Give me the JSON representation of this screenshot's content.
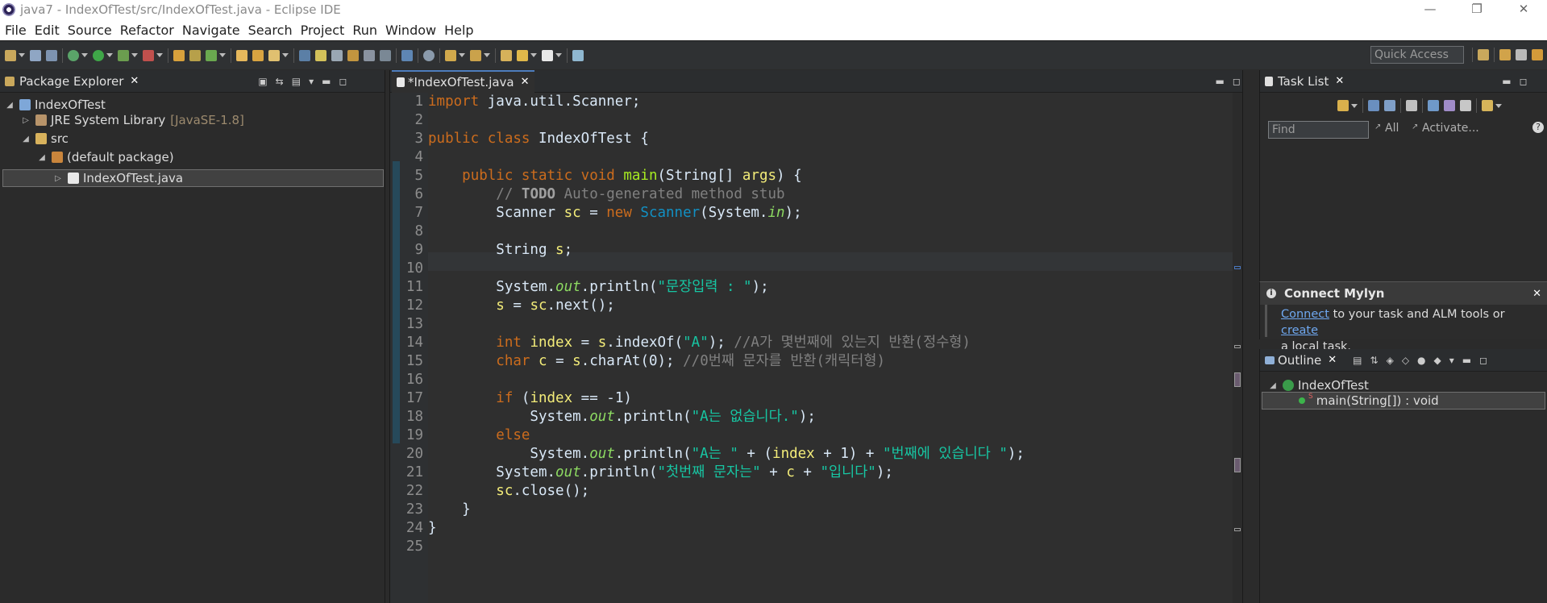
{
  "window": {
    "title": "java7 - IndexOfTest/src/IndexOfTest.java - Eclipse IDE",
    "minimize_glyph": "—",
    "restore_glyph": "❐",
    "close_glyph": "✕"
  },
  "menu": [
    "File",
    "Edit",
    "Source",
    "Refactor",
    "Navigate",
    "Search",
    "Project",
    "Run",
    "Window",
    "Help"
  ],
  "toolbar": {
    "quick_access_placeholder": "Quick Access"
  },
  "package_explorer": {
    "tab_label": "Package Explorer",
    "tree": [
      {
        "label": "IndexOfTest",
        "suffix": ""
      },
      {
        "label": "JRE System Library",
        "suffix": "[JavaSE-1.8]"
      },
      {
        "label": "src",
        "suffix": ""
      },
      {
        "label": "(default package)",
        "suffix": ""
      },
      {
        "label": "IndexOfTest.java",
        "suffix": ""
      }
    ]
  },
  "editor": {
    "tab_label": "*IndexOfTest.java",
    "line_numbers": [
      "1",
      "2",
      "3",
      "4",
      "5",
      "6",
      "7",
      "8",
      "9",
      "10",
      "11",
      "12",
      "13",
      "14",
      "15",
      "16",
      "17",
      "18",
      "19",
      "20",
      "21",
      "22",
      "23",
      "24",
      "25"
    ],
    "code": {
      "l1_import": "import",
      "l1_rest": " java.util.Scanner;",
      "l3_public": "public",
      "l3_class": " class",
      "l3_rest": " IndexOfTest {",
      "l5_indent": "    ",
      "l5_public": "public",
      "l5_static": " static",
      "l5_void": " void",
      "l5_main": " main",
      "l5_paren": "(String[] ",
      "l5_args": "args",
      "l5_end": ") {",
      "l6_indent": "        ",
      "l6_slash": "// ",
      "l6_todo": "TODO",
      "l6_rest": " Auto-generated method stub",
      "l7_a": "        Scanner ",
      "l7_sc": "sc",
      "l7_b": " = ",
      "l7_new": "new",
      "l7_scanner": " Scanner",
      "l7_c": "(System.",
      "l7_in": "in",
      "l7_d": ");",
      "l9_a": "        String ",
      "l9_s": "s",
      "l9_b": ";",
      "l11_a": "        System.",
      "l11_out": "out",
      "l11_b": ".println(",
      "l11_str": "\"문장입력 : \"",
      "l11_c": ");",
      "l12_indent": "        ",
      "l12_s": "s",
      "l12_b": " = ",
      "l12_sc": "sc",
      "l12_c": ".next();",
      "l14_indent": "        ",
      "l14_int": "int",
      "l14_sp": " ",
      "l14_index": "index",
      "l14_b": " = ",
      "l14_s": "s",
      "l14_c": ".indexOf(",
      "l14_str": "\"A\"",
      "l14_d": "); ",
      "l14_cmt": "//A가 몇번째에 있는지 반환(정수형)",
      "l15_indent": "        ",
      "l15_char": "char",
      "l15_sp": " ",
      "l15_c": "c",
      "l15_b": " = ",
      "l15_s": "s",
      "l15_d": ".charAt(0); ",
      "l15_cmt": "//0번째 문자를 반환(캐릭터형)",
      "l17_indent": "        ",
      "l17_if": "if",
      "l17_b": " (",
      "l17_index": "index",
      "l17_c": " == -1)",
      "l18_a": "            System.",
      "l18_out": "out",
      "l18_b": ".println(",
      "l18_str": "\"A는 없습니다.\"",
      "l18_c": ");",
      "l19_indent": "        ",
      "l19_else": "else",
      "l20_a": "            System.",
      "l20_out": "out",
      "l20_b": ".println(",
      "l20_str1": "\"A는 \"",
      "l20_c": " + (",
      "l20_index": "index",
      "l20_d": " + 1) + ",
      "l20_str2": "\"번째에 있습니다 \"",
      "l20_e": ");",
      "l21_a": "        System.",
      "l21_out": "out",
      "l21_b": ".println(",
      "l21_str1": "\"첫번째 문자는\"",
      "l21_c": " + ",
      "l21_cv": "c",
      "l21_d": " + ",
      "l21_str2": "\"입니다\"",
      "l21_e": ");",
      "l22_indent": "        ",
      "l22_sc": "sc",
      "l22_b": ".close();",
      "l23": "    }",
      "l24": "}"
    }
  },
  "task_list": {
    "tab_label": "Task List",
    "find_placeholder": "Find",
    "all_label": "All",
    "activate_label": "Activate..."
  },
  "mylyn": {
    "title": "Connect Mylyn",
    "connect_link": "Connect",
    "text_mid": " to your task and ALM tools or ",
    "create_link": "create",
    "text_end": "a local task."
  },
  "outline": {
    "tab_label": "Outline",
    "items": [
      {
        "label": "IndexOfTest"
      },
      {
        "label": "main(String[]) : void"
      }
    ]
  },
  "colors": {
    "keyword": "#cc6c1d",
    "string": "#17c6a3",
    "comment": "#808080",
    "method": "#a7ec21",
    "variable": "#f3ec79"
  }
}
